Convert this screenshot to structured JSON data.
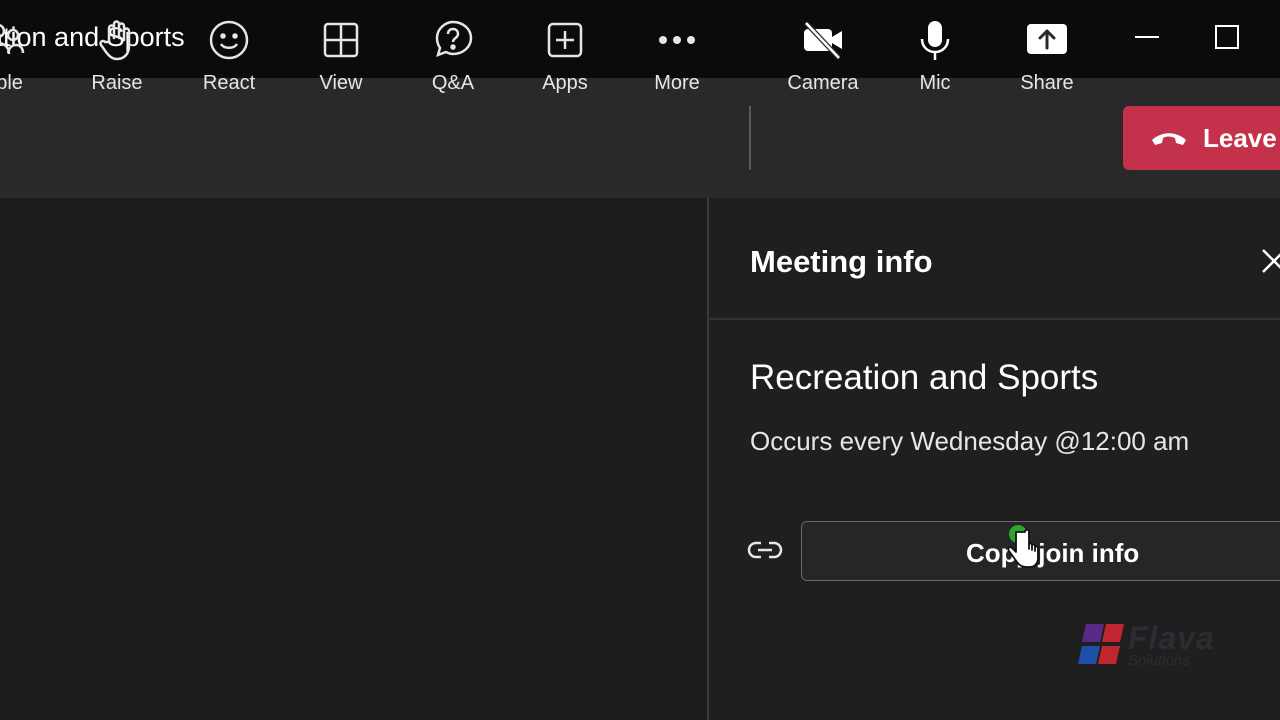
{
  "window": {
    "title": "ation and Sports"
  },
  "toolbar": {
    "items": [
      {
        "label": "ople",
        "icon": "people-icon"
      },
      {
        "label": "Raise",
        "icon": "hand-icon"
      },
      {
        "label": "React",
        "icon": "smiley-icon"
      },
      {
        "label": "View",
        "icon": "grid-icon"
      },
      {
        "label": "Q&A",
        "icon": "question-chat-icon"
      },
      {
        "label": "Apps",
        "icon": "plus-square-icon"
      },
      {
        "label": "More",
        "icon": "more-dots-icon"
      },
      {
        "label": "Camera",
        "icon": "camera-off-icon"
      },
      {
        "label": "Mic",
        "icon": "microphone-icon"
      },
      {
        "label": "Share",
        "icon": "share-upload-icon"
      }
    ],
    "leave_label": "Leave"
  },
  "panel": {
    "title": "Meeting info",
    "meeting_name": "Recreation and Sports",
    "schedule": "Occurs every Wednesday @12:00 am",
    "copy_button_label": "Copy join info"
  },
  "logo": {
    "text": "Flava",
    "sub": "Solutions"
  },
  "colors": {
    "leave_red": "#c4314b",
    "titlebar": "#0b0b0b",
    "toolbar": "#292929",
    "panel": "#1f1f1f"
  }
}
